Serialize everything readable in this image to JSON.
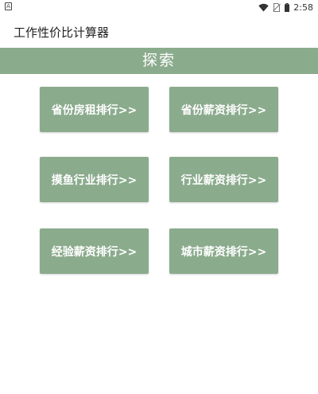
{
  "status_bar": {
    "notification_glyph": "A",
    "time": "2:58",
    "icons": [
      "wifi-icon",
      "no-sim-icon",
      "battery-icon"
    ]
  },
  "app_bar": {
    "title": "工作性价比计算器"
  },
  "banner": {
    "title": "探索"
  },
  "tiles": [
    {
      "label": "省份房租排行>>"
    },
    {
      "label": "省份薪资排行>>"
    },
    {
      "label": "摸鱼行业排行>>"
    },
    {
      "label": "行业薪资排行>>"
    },
    {
      "label": "经验薪资排行>>"
    },
    {
      "label": "城市薪资排行>>"
    }
  ],
  "colors": {
    "accent": "#8bab8d",
    "tile_text": "#ffffff",
    "background": "#ffffff"
  }
}
